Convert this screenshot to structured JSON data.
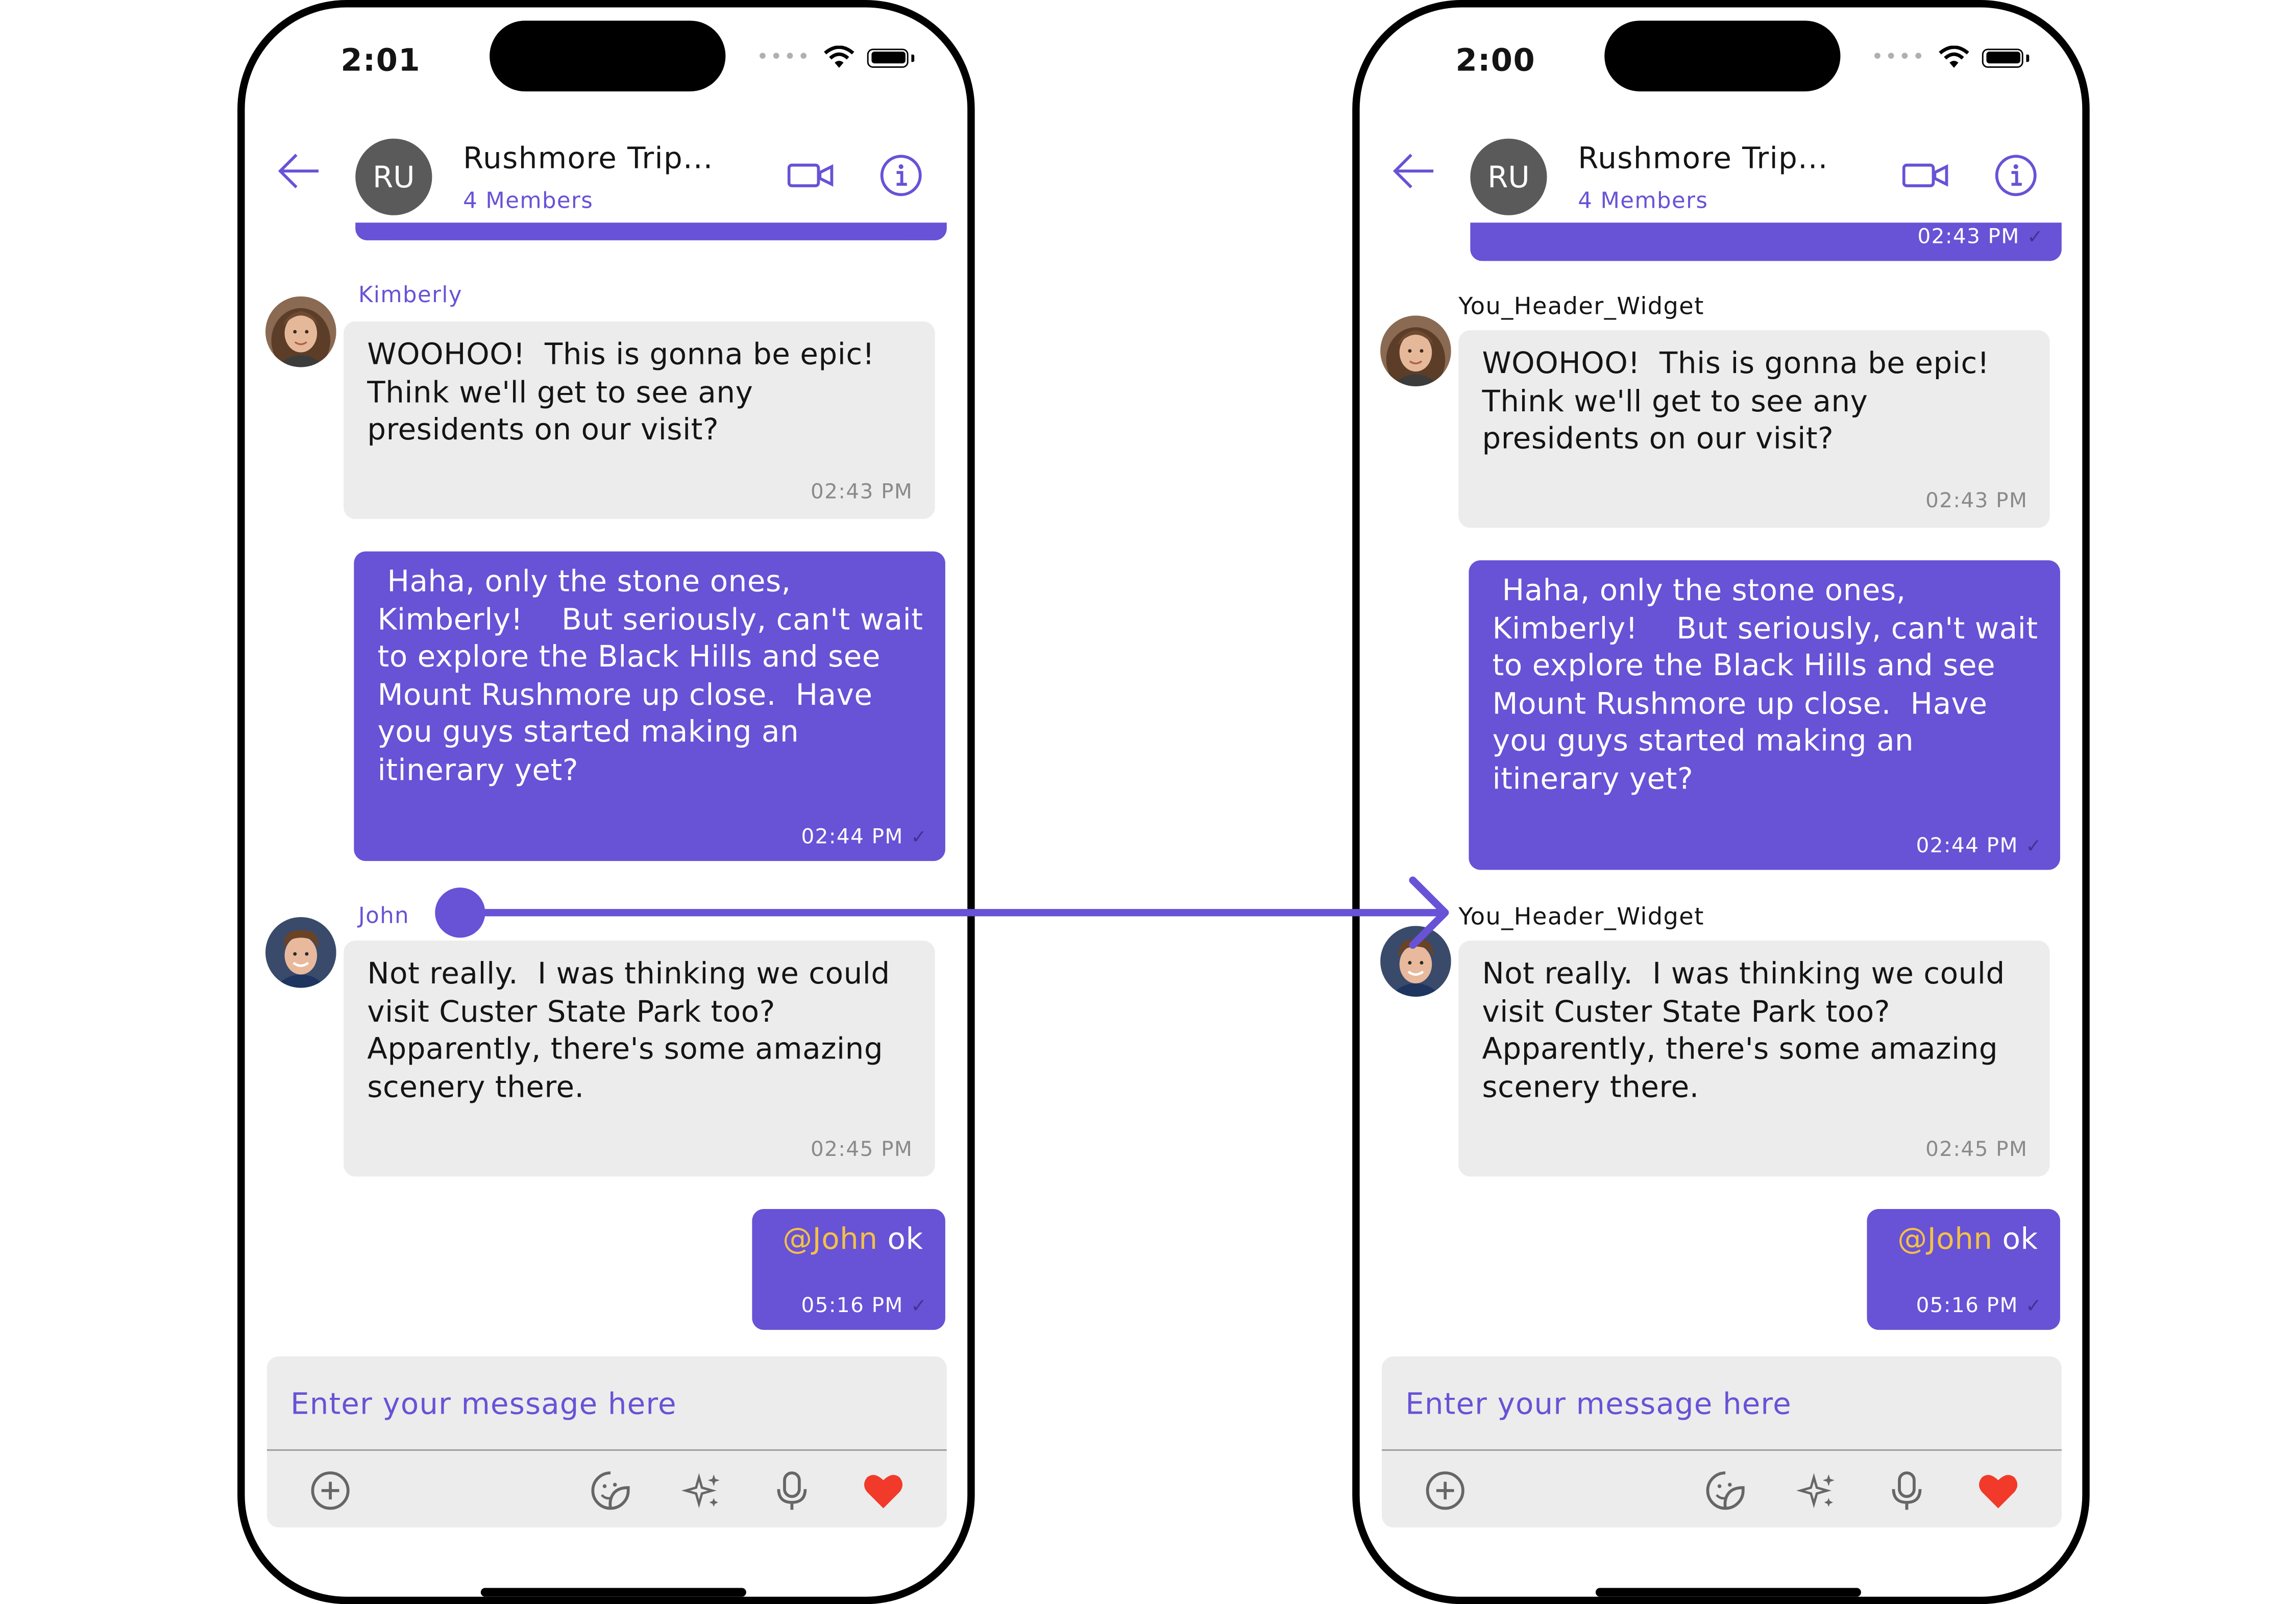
{
  "colors": {
    "brand": "#6852d6",
    "incoming_bubble": "#ececec",
    "mention": "#f4c146",
    "heart": "#f23a2a"
  },
  "left_phone": {
    "status": {
      "time": "2:01"
    },
    "header": {
      "avatar_initials": "RU",
      "title": "Rushmore Trip...",
      "subtitle": "4 Members"
    },
    "messages": [
      {
        "sender": "Kimberly",
        "text": "WOOHOO!  This is gonna be epic!\nThink we'll get to see any\npresidents on our visit?",
        "time": "02:43 PM"
      },
      {
        "text": " Haha, only the stone ones,\nKimberly!    But seriously, can't wait\nto explore the Black Hills and see\nMount Rushmore up close.  Have\nyou guys started making an\nitinerary yet?",
        "time": "02:44 PM"
      },
      {
        "sender": "John",
        "text": "Not really.  I was thinking we could\nvisit Custer State Park too?\nApparently, there's some amazing\nscenery there.",
        "time": "02:45 PM"
      },
      {
        "mention": "@John",
        "text": " ok",
        "time": "05:16 PM"
      }
    ],
    "composer": {
      "placeholder": "Enter your message here"
    }
  },
  "right_phone": {
    "status": {
      "time": "2:00"
    },
    "header": {
      "avatar_initials": "RU",
      "title": "Rushmore Trip...",
      "subtitle": "4 Members"
    },
    "top_partial_time": "02:43 PM",
    "messages": [
      {
        "sender": "You_Header_Widget",
        "text": "WOOHOO!  This is gonna be epic!\nThink we'll get to see any\npresidents on our visit?",
        "time": "02:43 PM"
      },
      {
        "text": " Haha, only the stone ones,\nKimberly!    But seriously, can't wait\nto explore the Black Hills and see\nMount Rushmore up close.  Have\nyou guys started making an\nitinerary yet?",
        "time": "02:44 PM"
      },
      {
        "sender": "You_Header_Widget",
        "text": "Not really.  I was thinking we could\nvisit Custer State Park too?\nApparently, there's some amazing\nscenery there.",
        "time": "02:45 PM"
      },
      {
        "mention": "@John",
        "text": " ok",
        "time": "05:16 PM"
      }
    ],
    "composer": {
      "placeholder": "Enter your message here"
    }
  },
  "icons": {
    "back": "arrow-left-icon",
    "video": "video-call-icon",
    "info": "info-icon",
    "add": "plus-circle-icon",
    "sticker": "sticker-icon",
    "ai": "sparkles-icon",
    "mic": "microphone-icon",
    "heart": "heart-icon",
    "read": "check-icon"
  }
}
